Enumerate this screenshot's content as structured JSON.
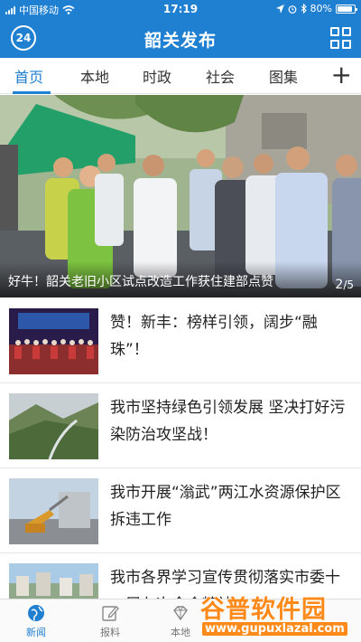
{
  "status_bar": {
    "carrier": "中国移动",
    "time": "17:19",
    "battery": "80%"
  },
  "header": {
    "badge": "24",
    "title": "韶关发布"
  },
  "tabs": [
    {
      "label": "首页",
      "active": true
    },
    {
      "label": "本地"
    },
    {
      "label": "时政"
    },
    {
      "label": "社会"
    },
    {
      "label": "图集"
    }
  ],
  "banner": {
    "caption": "好牛！韶关老旧小区试点改造工作获住建部点赞",
    "pager_current": "2",
    "pager_total": "5"
  },
  "news": [
    {
      "title": "赞！新丰：榜样引领，阔步“融珠”！"
    },
    {
      "title": "我市坚持绿色引领发展 坚决打好污染防治攻坚战！"
    },
    {
      "title": "我市开展“滃武”两江水资源保护区拆违工作"
    },
    {
      "title": "我市各界学习宣传贯彻落实市委十二届七次全会精神"
    }
  ],
  "bottom_nav": [
    {
      "label": "新闻",
      "icon": "globe-icon",
      "active": true
    },
    {
      "label": "报料",
      "icon": "edit-icon"
    },
    {
      "label": "本地",
      "icon": "diamond-icon"
    }
  ],
  "watermark": {
    "main": "谷普软件园",
    "url": "www.gupuxlazal.com"
  },
  "colors": {
    "brand": "#1f7fd1",
    "watermark": "#ff8a1a"
  }
}
